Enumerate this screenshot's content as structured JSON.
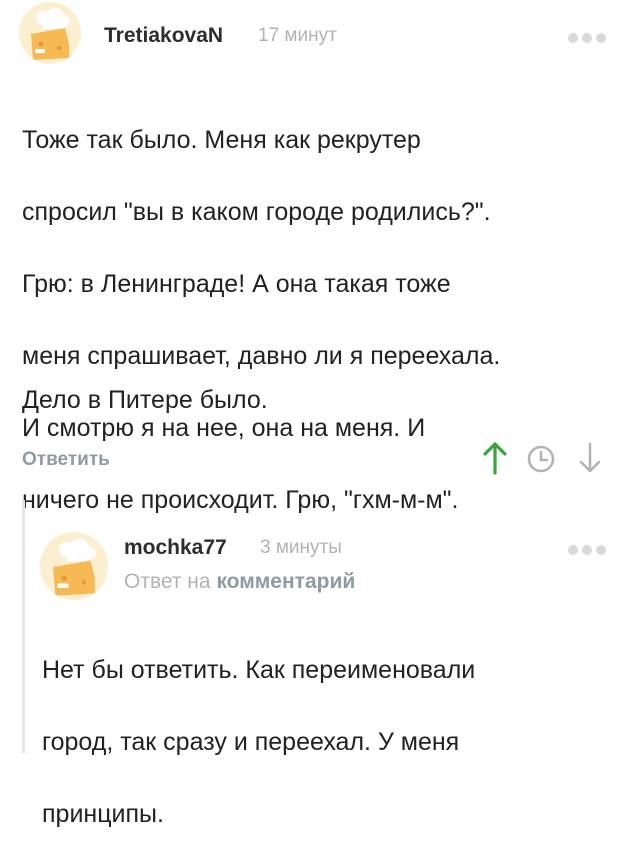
{
  "comment": {
    "author": "TretiakovaN",
    "time": "17 минут",
    "avatar_icon": "cheese-chef-avatar-icon",
    "text_lines": [
      "Тоже так было. Меня как рекрутер",
      "спросил \"вы в каком городе родились?\".",
      "Грю: в Ленинграде! А она такая тоже",
      "меня спрашивает, давно ли я переехала.",
      "И смотрю я на нее, она на меня. И",
      "ничего не происходит. Грю, \"гхм-м-м\"."
    ],
    "text_extra": "Дело в Питере было.",
    "reply_label": "Ответить",
    "icons": {
      "upvote": "arrow-up-icon",
      "save": "clock-icon",
      "downvote": "arrow-down-icon",
      "more": "more-dots-icon"
    },
    "colors": {
      "upvote": "#3aa33a",
      "muted": "#b3b3b3",
      "link": "#8f9ba3"
    }
  },
  "reply": {
    "author": "mochka77",
    "time": "3 минуты",
    "avatar_icon": "cheese-chef-avatar-icon",
    "reply_to_prefix": "Ответ на",
    "reply_to_link": "комментарий",
    "text_lines": [
      "Нет бы ответить. Как переименовали",
      "город, так сразу и переехал. У меня",
      "принципы."
    ]
  }
}
